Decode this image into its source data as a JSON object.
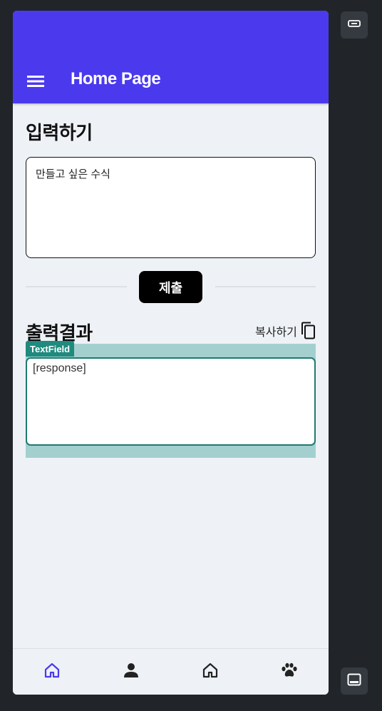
{
  "app_bar": {
    "title": "Home Page",
    "menu_icon": "menu-icon",
    "color": "#4b3aed"
  },
  "input_section": {
    "title": "입력하기",
    "field_placeholder": "만들고 싶은 수식"
  },
  "submit": {
    "label": "제출"
  },
  "output_section": {
    "title": "출력결과",
    "copy_label": "복사하기",
    "copy_icon": "copy-icon",
    "debug_tag": "TextField",
    "response_text": "[response]"
  },
  "bottom_nav": {
    "items": [
      {
        "icon": "home-icon",
        "active": true,
        "color": "#4b3aed"
      },
      {
        "icon": "person-icon",
        "active": false,
        "color": "#222222"
      },
      {
        "icon": "home-icon",
        "active": false,
        "color": "#222222"
      },
      {
        "icon": "paw-icon",
        "active": false,
        "color": "#222222"
      }
    ]
  },
  "side_tools": {
    "top_icon": "widget-select-icon",
    "bottom_icon": "panel-bottom-icon"
  }
}
